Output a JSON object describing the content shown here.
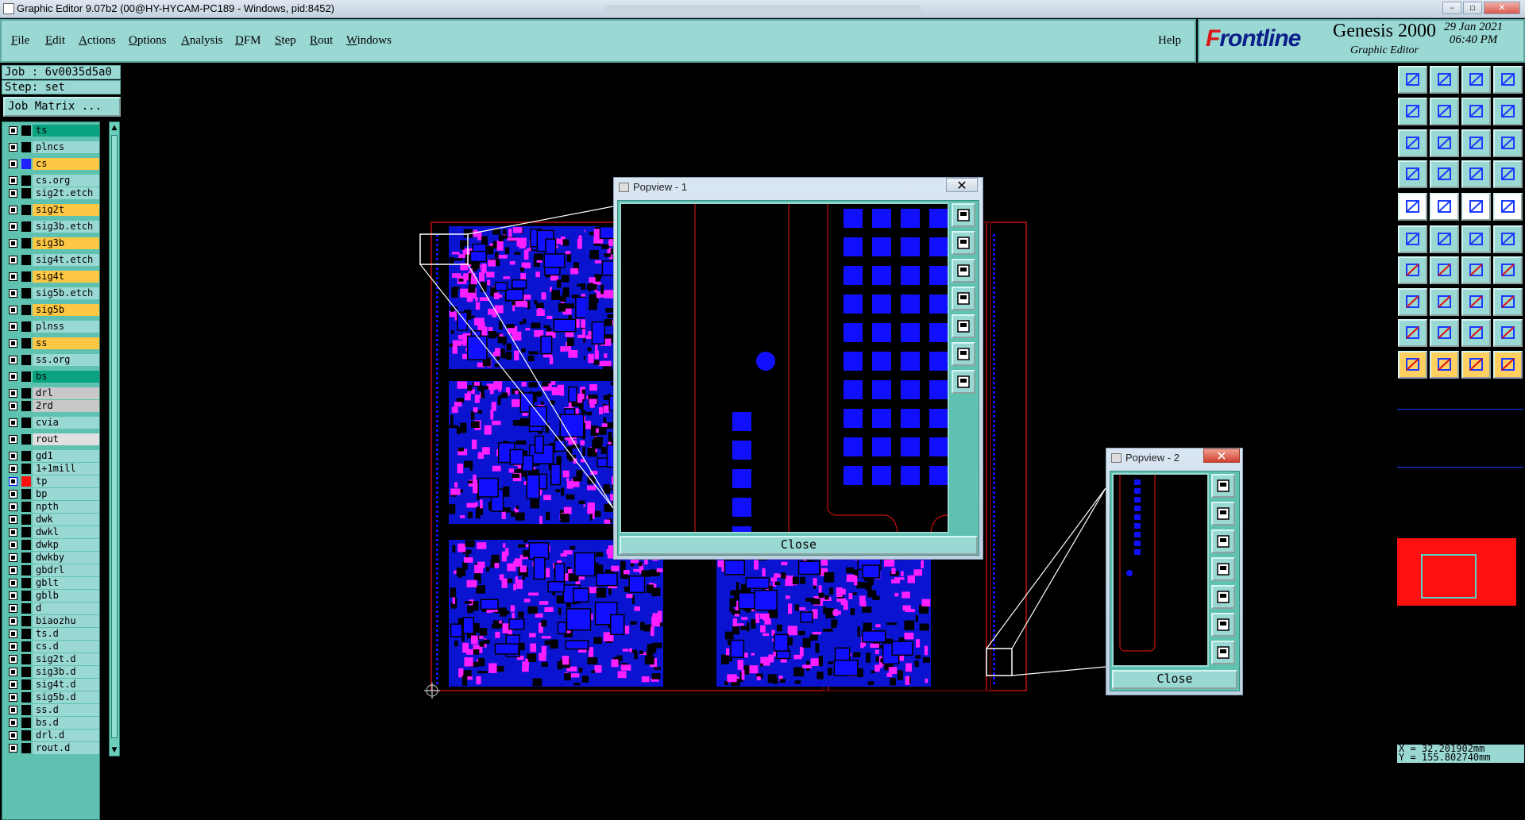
{
  "window": {
    "title": "Graphic Editor 9.07b2 (00@HY-HYCAM-PC189 - Windows, pid:8452)"
  },
  "menu": {
    "items": [
      {
        "label": "File",
        "u": "F",
        "rest": "ile"
      },
      {
        "label": "Edit",
        "u": "E",
        "rest": "dit"
      },
      {
        "label": "Actions",
        "u": "A",
        "rest": "ctions"
      },
      {
        "label": "Options",
        "u": "O",
        "rest": "ptions"
      },
      {
        "label": "Analysis",
        "u": "A",
        "rest": "nalysis"
      },
      {
        "label": "DFM",
        "u": "D",
        "rest": "FM"
      },
      {
        "label": "Step",
        "u": "S",
        "rest": "tep"
      },
      {
        "label": "Rout",
        "u": "R",
        "rest": "out"
      },
      {
        "label": "Windows",
        "u": "W",
        "rest": "indows"
      }
    ],
    "help": "Help"
  },
  "brand": {
    "logo_f": "F",
    "logo_rest": "rontline",
    "product": "Genesis 2000",
    "subtitle": "Graphic Editor",
    "date": "29 Jan 2021",
    "time": "06:40 PM"
  },
  "job": {
    "job_line": "Job : 6v0035d5a0",
    "step_line": "Step: set",
    "matrix_button": "Job Matrix ..."
  },
  "layers": [
    {
      "name": "ts",
      "color": "#0aa37f",
      "swatch": "#000"
    },
    {
      "name": "plncs",
      "color": "#9ad8d3",
      "swatch": "#000"
    },
    {
      "name": "cs",
      "color": "#ffc844",
      "swatch": "#2020ff"
    },
    {
      "name": "cs.org",
      "color": "#9ad8d3",
      "swatch": "#000"
    },
    {
      "name": "sig2t.etch",
      "color": "#9ad8d3",
      "swatch": "#000"
    },
    {
      "name": "sig2t",
      "color": "#ffc844",
      "swatch": "#000"
    },
    {
      "name": "sig3b.etch",
      "color": "#9ad8d3",
      "swatch": "#000"
    },
    {
      "name": "sig3b",
      "color": "#ffc844",
      "swatch": "#000"
    },
    {
      "name": "sig4t.etch",
      "color": "#9ad8d3",
      "swatch": "#000"
    },
    {
      "name": "sig4t",
      "color": "#ffc844",
      "swatch": "#000"
    },
    {
      "name": "sig5b.etch",
      "color": "#9ad8d3",
      "swatch": "#000"
    },
    {
      "name": "sig5b",
      "color": "#ffc844",
      "swatch": "#000"
    },
    {
      "name": "plnss",
      "color": "#9ad8d3",
      "swatch": "#000"
    },
    {
      "name": "ss",
      "color": "#ffc844",
      "swatch": "#000"
    },
    {
      "name": "ss.org",
      "color": "#9ad8d3",
      "swatch": "#000"
    },
    {
      "name": "bs",
      "color": "#0aa37f",
      "swatch": "#000"
    },
    {
      "name": "drl",
      "color": "#c8c8c8",
      "swatch": "#000"
    },
    {
      "name": "2rd",
      "color": "#c8c8c8",
      "swatch": "#000"
    },
    {
      "name": "cvia",
      "color": "#9ad8d3",
      "swatch": "#000"
    },
    {
      "name": "rout",
      "color": "#e0e0e0",
      "swatch": "#000"
    },
    {
      "name": "gd1",
      "color": "#9ad8d3",
      "swatch": "#000"
    },
    {
      "name": "1+1mill",
      "color": "#9ad8d3",
      "swatch": "#000"
    },
    {
      "name": "tp",
      "color": "#9ad8d3",
      "swatch": "#ff1010"
    },
    {
      "name": "bp",
      "color": "#9ad8d3",
      "swatch": "#000"
    },
    {
      "name": "npth",
      "color": "#9ad8d3",
      "swatch": "#000"
    },
    {
      "name": "dwk",
      "color": "#9ad8d3",
      "swatch": "#000"
    },
    {
      "name": "dwkl",
      "color": "#9ad8d3",
      "swatch": "#000"
    },
    {
      "name": "dwkp",
      "color": "#9ad8d3",
      "swatch": "#000"
    },
    {
      "name": "dwkby",
      "color": "#9ad8d3",
      "swatch": "#000"
    },
    {
      "name": "gbdrl",
      "color": "#9ad8d3",
      "swatch": "#000"
    },
    {
      "name": "gblt",
      "color": "#9ad8d3",
      "swatch": "#000"
    },
    {
      "name": "gblb",
      "color": "#9ad8d3",
      "swatch": "#000"
    },
    {
      "name": "d",
      "color": "#9ad8d3",
      "swatch": "#000"
    },
    {
      "name": "biaozhu",
      "color": "#9ad8d3",
      "swatch": "#000"
    },
    {
      "name": "ts.d",
      "color": "#9ad8d3",
      "swatch": "#000"
    },
    {
      "name": "cs.d",
      "color": "#9ad8d3",
      "swatch": "#000"
    },
    {
      "name": "sig2t.d",
      "color": "#9ad8d3",
      "swatch": "#000"
    },
    {
      "name": "sig3b.d",
      "color": "#9ad8d3",
      "swatch": "#000"
    },
    {
      "name": "sig4t.d",
      "color": "#9ad8d3",
      "swatch": "#000"
    },
    {
      "name": "sig5b.d",
      "color": "#9ad8d3",
      "swatch": "#000"
    },
    {
      "name": "ss.d",
      "color": "#9ad8d3",
      "swatch": "#000"
    },
    {
      "name": "bs.d",
      "color": "#9ad8d3",
      "swatch": "#000"
    },
    {
      "name": "drl.d",
      "color": "#9ad8d3",
      "swatch": "#000"
    },
    {
      "name": "rout.d",
      "color": "#9ad8d3",
      "swatch": "#000"
    }
  ],
  "popview1": {
    "title": "Popview - 1",
    "close": "Close"
  },
  "popview2": {
    "title": "Popview - 2",
    "close": "Close"
  },
  "status": {
    "x": "X = 32.201902mm",
    "y": "Y = 155.802740mm"
  },
  "colors": {
    "copper": "#1010ff",
    "pad": "#ff20ff",
    "outline": "#c01010",
    "panel": "#9ad8d3"
  }
}
